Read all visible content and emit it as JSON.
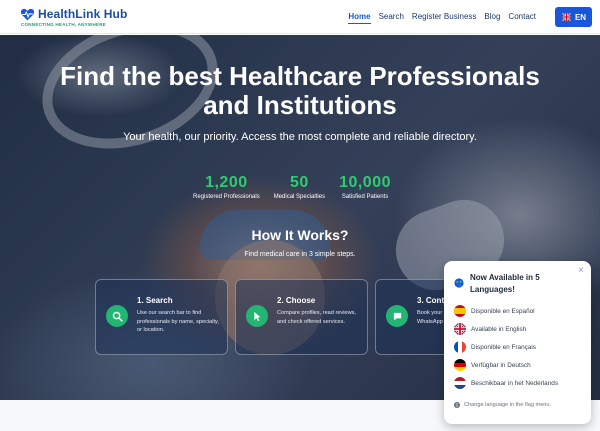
{
  "logo": {
    "title_part1": "HealthLink",
    "title_part2": "Hub",
    "tagline": "CONNECTING HEALTH, ANYWHERE"
  },
  "nav": {
    "items": [
      "Home",
      "Search",
      "Register Business",
      "Blog",
      "Contact"
    ],
    "active": "Home"
  },
  "lang_button": {
    "label": "EN",
    "flag": "uk-flag"
  },
  "hero": {
    "title_line1": "Find the best Healthcare Professionals",
    "title_line2": "and Institutions",
    "subtitle": "Your health, our priority. Access the most complete and reliable directory."
  },
  "stats": [
    {
      "value": "1,200",
      "label": "Registered Professionals"
    },
    {
      "value": "50",
      "label": "Medical Specialties"
    },
    {
      "value": "10,000",
      "label": "Satisfied Patients"
    }
  ],
  "how_it_works": {
    "title": "How It Works?",
    "subtitle": "Find medical care in 3 simple steps.",
    "steps": [
      {
        "title": "1. Search",
        "text": "Use our search bar to find professionals by name, specialty, or location.",
        "icon": "search-icon"
      },
      {
        "title": "2. Choose",
        "text": "Compare profiles, read reviews, and check offered services.",
        "icon": "pointer-icon"
      },
      {
        "title": "3. Contact",
        "text": "Book your appointment directly by WhatsApp or visit their website.",
        "icon": "chat-icon"
      }
    ]
  },
  "language_popup": {
    "title": "Now Available in 5 Languages!",
    "close": "×",
    "languages": [
      {
        "label": "Disponible en Español",
        "flag": "es-flag"
      },
      {
        "label": "Available in English",
        "flag": "uk-flag"
      },
      {
        "label": "Disponible en Français",
        "flag": "fr-flag"
      },
      {
        "label": "Verfügbar in Deutsch",
        "flag": "de-flag"
      },
      {
        "label": "Beschikbaar in het Nederlands",
        "flag": "nl-flag"
      }
    ],
    "footer": "Change language in the flag menu."
  },
  "colors": {
    "brand_blue": "#1a56db",
    "accent_green": "#22b573",
    "stat_green": "#2ecc71"
  }
}
